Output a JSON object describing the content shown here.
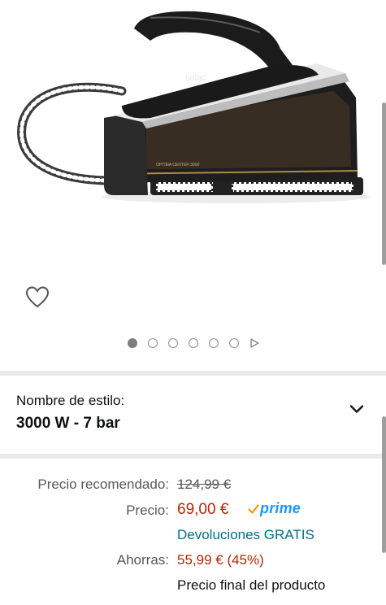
{
  "product": {
    "brand": "solac",
    "model_text": "OPTIMA CENTER 3000"
  },
  "carousel": {
    "total_images": 6,
    "active_index": 0
  },
  "style_selector": {
    "label": "Nombre de estilo:",
    "value": "3000 W - 7 bar"
  },
  "pricing": {
    "recommended_label": "Precio recomendado:",
    "recommended_value": "124,99 €",
    "price_label": "Precio:",
    "price_value": "69,00 €",
    "prime_label": "prime",
    "returns_text": "Devoluciones GRATIS",
    "savings_label": "Ahorras:",
    "savings_value": "55,99 € (45%)",
    "final_note": "Precio final del producto"
  },
  "colors": {
    "price_red": "#b12704",
    "link_teal": "#007185",
    "prime_blue": "#1a98ff",
    "prime_check": "#ff9900"
  }
}
